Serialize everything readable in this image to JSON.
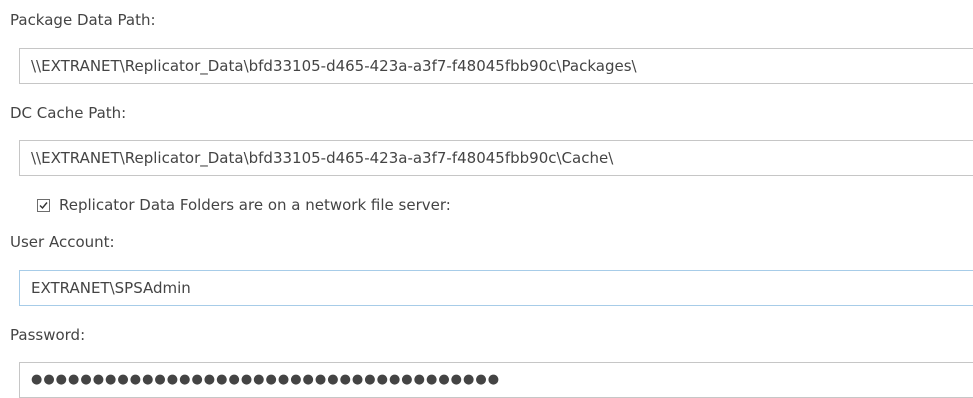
{
  "package_data_path": {
    "label": "Package Data Path:",
    "value": "\\\\EXTRANET\\Replicator_Data\\bfd33105-d465-423a-a3f7-f48045fbb90c\\Packages\\"
  },
  "dc_cache_path": {
    "label": "DC Cache Path:",
    "value": "\\\\EXTRANET\\Replicator_Data\\bfd33105-d465-423a-a3f7-f48045fbb90c\\Cache\\"
  },
  "network_file_server": {
    "label": "Replicator Data Folders are on a network file server:",
    "checked": true
  },
  "user_account": {
    "label": "User Account:",
    "value": "EXTRANET\\SPSAdmin"
  },
  "password": {
    "label": "Password:",
    "masked_value": "●●●●●●●●●●●●●●●●●●●●●●●●●●●●●●●●●●●●●●"
  },
  "colors": {
    "text": "#444444",
    "field_border": "#c6c6c6",
    "focused_border": "#a7cce8"
  }
}
